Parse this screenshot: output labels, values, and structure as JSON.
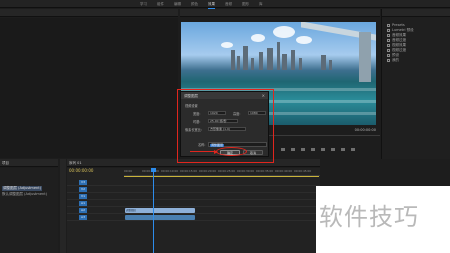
{
  "workspace_tabs": [
    {
      "label": "学习",
      "active": false
    },
    {
      "label": "组件",
      "active": false
    },
    {
      "label": "编辑",
      "active": false
    },
    {
      "label": "颜色",
      "active": false
    },
    {
      "label": "效果",
      "active": true
    },
    {
      "label": "音频",
      "active": false
    },
    {
      "label": "图形",
      "active": false
    },
    {
      "label": "库",
      "active": false
    }
  ],
  "program_monitor": {
    "timecode_left": "00:00:00:00",
    "timecode_right": "00:00:00:00"
  },
  "right_panel": {
    "items": [
      "Presets",
      "Lumetri 预设",
      "音频效果",
      "音频过渡",
      "视频效果",
      "视频过渡",
      "预设",
      "我的"
    ]
  },
  "project": {
    "title": "项目",
    "rows": [
      "调整图层 (Adjustment)",
      "默认调整图层 (Adjustment)"
    ]
  },
  "timeline": {
    "title": "序列 01",
    "timecode": "00:00:00:00",
    "ruler_ticks": [
      "00:00",
      "00:00:05:00",
      "00:00:10:00",
      "00:00:15:00",
      "00:00:20:00",
      "00:00:25:00",
      "00:00:30:00",
      "00:00:35:00",
      "00:00:40:00",
      "00:00:45:00"
    ],
    "tracks": [
      "V3",
      "V2",
      "V1",
      "A1",
      "A2",
      "A3"
    ],
    "clip_label": "调整图层"
  },
  "dialog": {
    "title": "调整图层",
    "section": "视频设置",
    "width_label": "宽度:",
    "width_value": "1920",
    "height_label": "高度:",
    "height_value": "1080",
    "timebase_label": "时基:",
    "timebase_value": "25.00 帧/秒",
    "par_label": "像素长宽比:",
    "par_value": "方形像素 (1.0)",
    "name_label": "名称:",
    "name_value": "调整图层",
    "ok_label": "确定",
    "cancel_label": "取消",
    "close_glyph": "×"
  },
  "watermark": {
    "text": "软件技巧"
  },
  "colors": {
    "highlight_red": "#e0261e",
    "accent_blue": "#2d8ceb",
    "timecode_yellow": "#d8c15a"
  }
}
